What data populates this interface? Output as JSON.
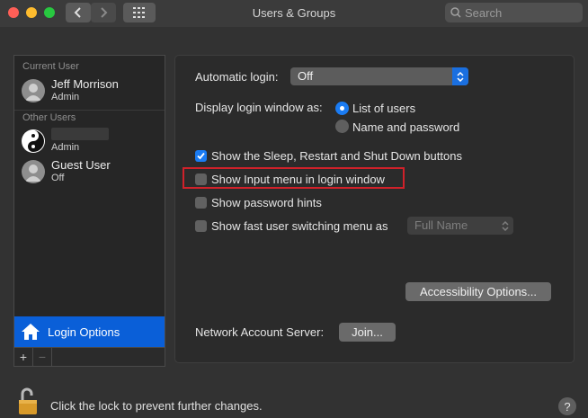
{
  "window": {
    "title": "Users & Groups",
    "search_placeholder": "Search"
  },
  "sidebar": {
    "current_user_header": "Current User",
    "current_user": {
      "name": "Jeff Morrison",
      "role": "Admin"
    },
    "other_users_header": "Other Users",
    "other_users": [
      {
        "name": "",
        "role": "Admin"
      },
      {
        "name": "Guest User",
        "role": "Off"
      }
    ],
    "login_options_label": "Login Options",
    "add_label": "+",
    "remove_label": "−"
  },
  "panel": {
    "automatic_login_label": "Automatic login:",
    "automatic_login_value": "Off",
    "display_login_label": "Display login window as:",
    "radio_list_label": "List of users",
    "radio_name_label": "Name and password",
    "radio_selected": "list",
    "checkboxes": [
      {
        "label": "Show the Sleep, Restart and Shut Down buttons",
        "checked": true
      },
      {
        "label": "Show Input menu in login window",
        "checked": false
      },
      {
        "label": "Show password hints",
        "checked": false
      },
      {
        "label": "Show fast user switching menu as",
        "checked": false
      }
    ],
    "fast_switch_value": "Full Name",
    "accessibility_button": "Accessibility Options...",
    "network_label": "Network Account Server:",
    "join_button": "Join..."
  },
  "footer": {
    "lock_text": "Click the lock to prevent further changes.",
    "help_label": "?"
  },
  "colors": {
    "accent": "#1a7bf2",
    "selection": "#0a5fd8",
    "highlight": "#d0212a"
  }
}
